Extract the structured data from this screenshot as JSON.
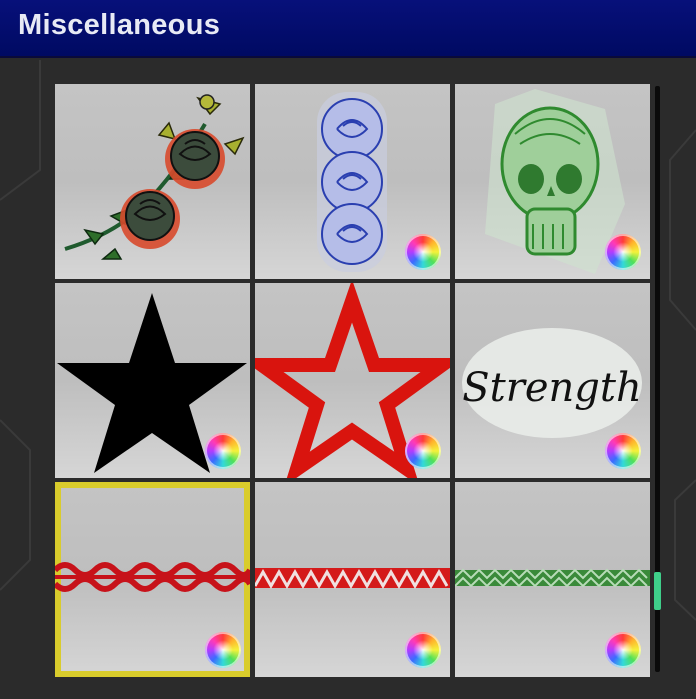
{
  "header": {
    "title": "Miscellaneous"
  },
  "items": [
    {
      "name": "Rose Vine",
      "icon": "roses-tattoo"
    },
    {
      "name": "Blue Roses",
      "icon": "blue-roses-tattoo"
    },
    {
      "name": "Green Skull",
      "icon": "skull-tattoo"
    },
    {
      "name": "Black Star",
      "icon": "black-star-tattoo"
    },
    {
      "name": "Red Star Outline",
      "icon": "red-star-tattoo"
    },
    {
      "name": "Strength",
      "icon": "strength-script-tattoo",
      "text": "Strength"
    },
    {
      "name": "Tribal Band",
      "icon": "tribal-band-tattoo",
      "selected": true
    },
    {
      "name": "Zigzag Band",
      "icon": "zigzag-band-tattoo"
    },
    {
      "name": "Braid Band",
      "icon": "braid-band-tattoo"
    }
  ],
  "colors": {
    "header": "#07107a",
    "selection": "#d9cc2c",
    "scroll_thumb": "#3fcf8a"
  },
  "scroll": {
    "position": 0.85
  }
}
